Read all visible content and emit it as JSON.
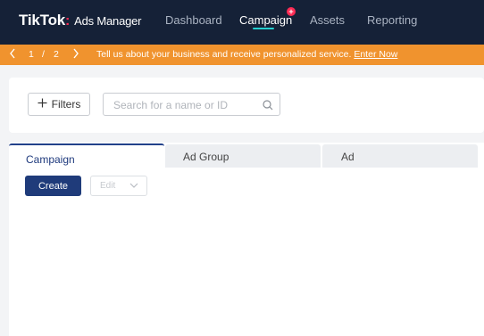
{
  "brand": {
    "name": "TikTok",
    "dot": ":",
    "product": "Ads Manager"
  },
  "nav": {
    "items": [
      "Dashboard",
      "Campaign",
      "Assets",
      "Reporting"
    ],
    "active": "Campaign",
    "badge": "+"
  },
  "banner": {
    "page_current": "1",
    "page_sep": "/",
    "page_total": "2",
    "message": "Tell us about your business and receive personalized service.",
    "link": "Enter Now",
    "color": "#f0932e"
  },
  "filters": {
    "button_label": "Filters",
    "search_placeholder": "Search for a name or ID"
  },
  "tabs": [
    "Campaign",
    "Ad Group",
    "Ad"
  ],
  "actions": {
    "create_label": "Create",
    "edit_label": "Edit"
  },
  "colors": {
    "nav_bg": "#152137",
    "primary": "#1f3b7a",
    "accent": "#25d0d0",
    "badge": "#fe2c55"
  }
}
